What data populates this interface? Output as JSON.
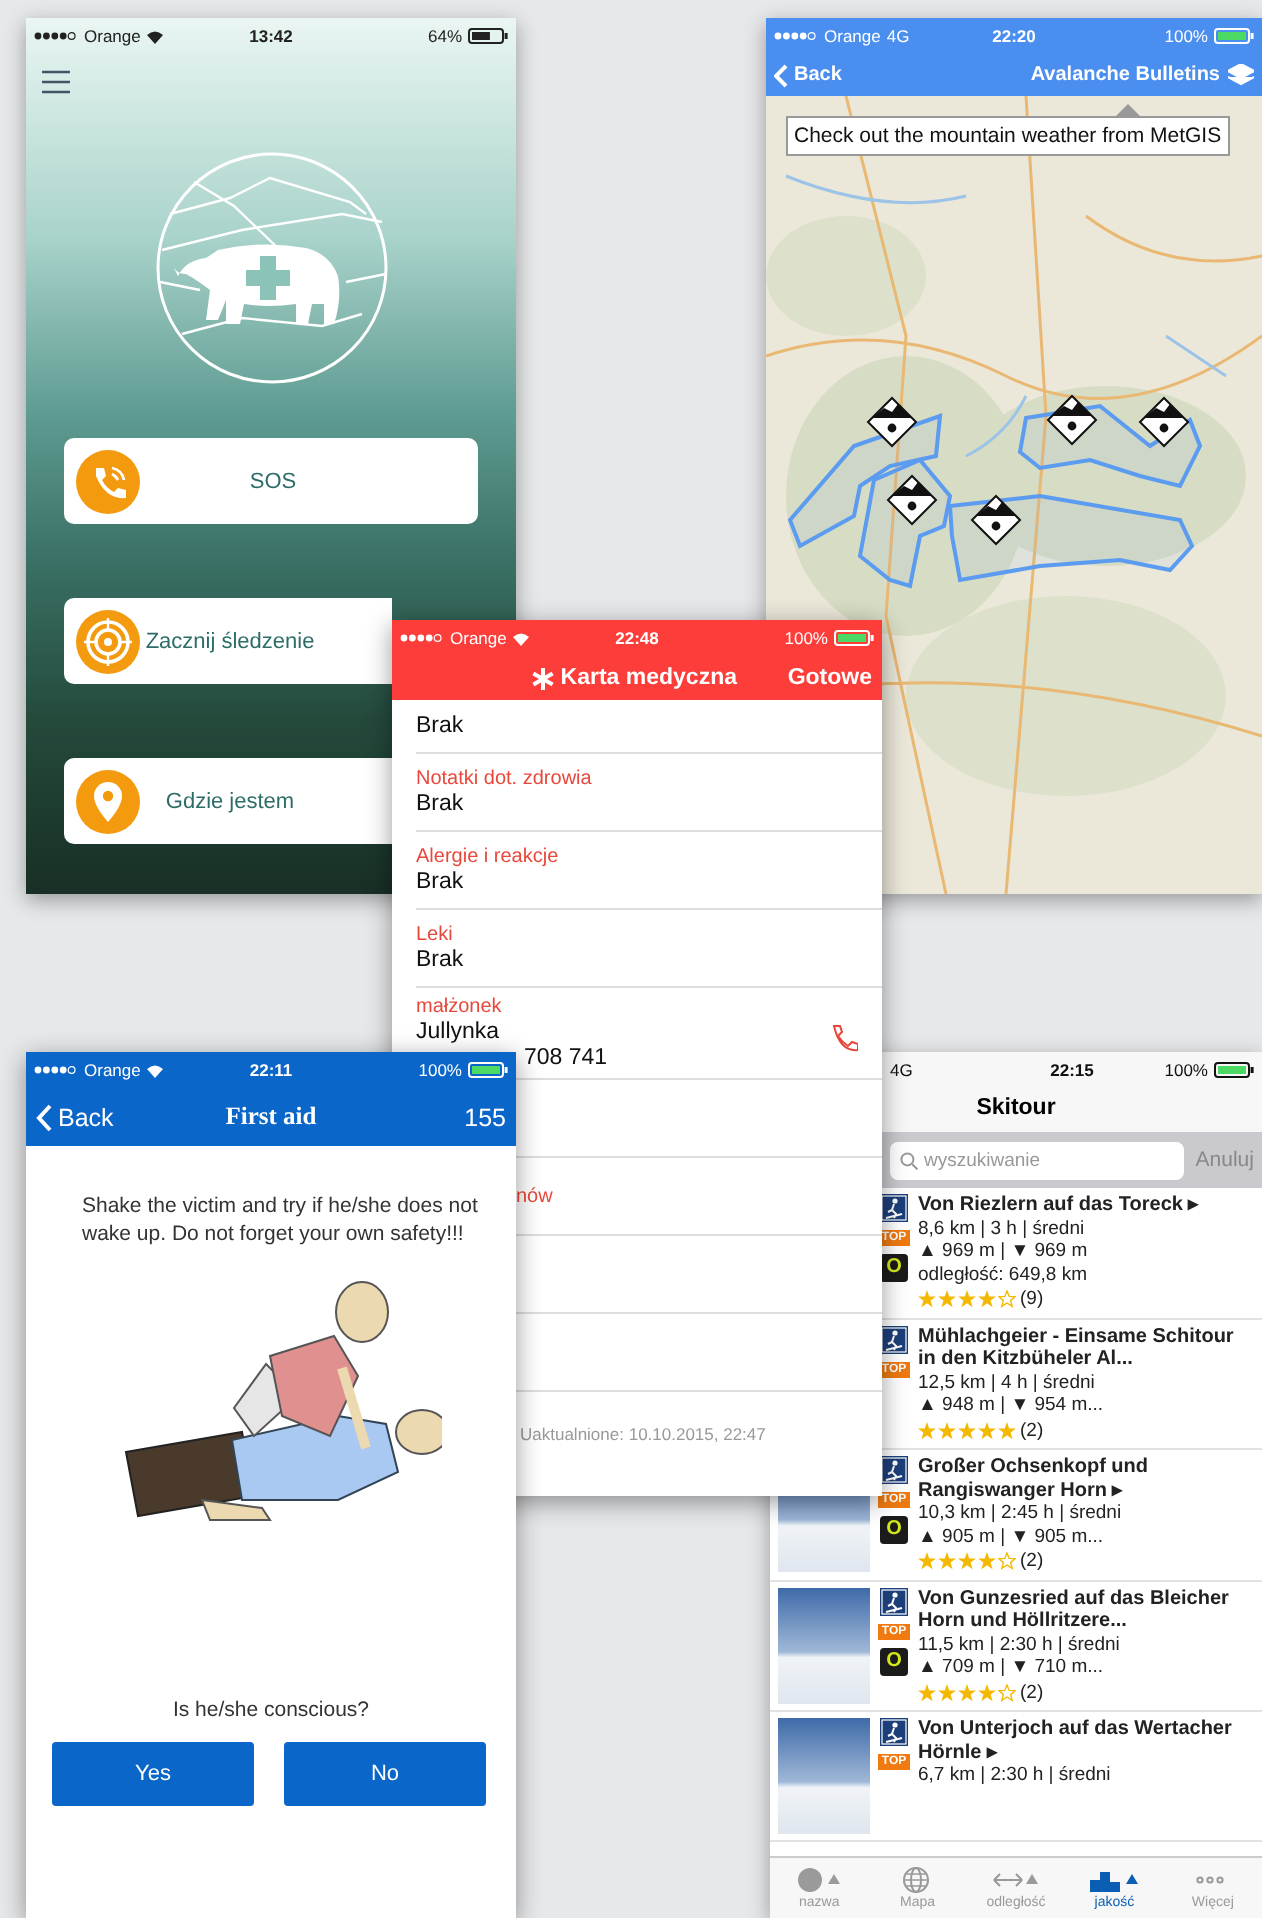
{
  "home_screen": {
    "status_bar": {
      "carrier": "Orange",
      "time": "13:42",
      "battery": "64%"
    },
    "buttons": [
      {
        "label": "SOS",
        "kind": "phone"
      },
      {
        "label": "Zacznij śledzenie",
        "kind": "target"
      },
      {
        "label": "Gdzie jestem",
        "kind": "pin"
      }
    ]
  },
  "map_screen": {
    "status_bar": {
      "carrier": "Orange",
      "network": "4G",
      "time": "22:20",
      "battery": "100%"
    },
    "back": "Back",
    "title": "Avalanche Bulletins",
    "banner": "Check out the mountain weather from MetGIS"
  },
  "skitour": {
    "status_bar": {
      "network": "4G",
      "time": "22:15",
      "battery": "100%"
    },
    "title": "Skitour",
    "search": {
      "placeholder": "wyszukiwanie"
    },
    "cancel": "Anuluj",
    "tours": [
      {
        "title": "Von Riezlern auf das Toreck ▸",
        "details": [
          "8,6 km | 3 h | średni",
          "▲ 969 m | ▼ 969 m",
          "odległość: 649,8 km"
        ],
        "top": "TOP",
        "grade": "O",
        "stars": 4,
        "reviews": "(9)"
      },
      {
        "title": "Mühlachgeier - Einsame Schitour in den Kitzbüheler Al...",
        "details": [
          "12,5 km | 4 h | średni",
          "▲ 948 m | ▼ 954 m..."
        ],
        "top": "TOP",
        "stars": 5,
        "reviews": "(2)"
      },
      {
        "title": "Großer Ochsenkopf und Rangiswanger Horn ▸",
        "details": [
          "10,3 km | 2:45 h | średni",
          "▲ 905 m | ▼ 905 m..."
        ],
        "top": "TOP",
        "grade": "O",
        "stars": 4,
        "reviews": "(2)"
      },
      {
        "title": "Von Gunzesried auf das Bleicher Horn und Höllritzere...",
        "details": [
          "11,5 km | 2:30 h | średni",
          "▲ 709 m | ▼ 710 m..."
        ],
        "top": "TOP",
        "grade": "O",
        "stars": 4,
        "reviews": "(2)"
      },
      {
        "title": "Von Unterjoch auf das Wertacher Hörnle ▸",
        "details": [
          "6,7 km | 2:30 h | średni"
        ],
        "top": "TOP"
      }
    ],
    "tabs": [
      {
        "label": "nazwa",
        "selected": false
      },
      {
        "label": "Mapa",
        "selected": false
      },
      {
        "label": "odległość",
        "selected": false
      },
      {
        "label": "jakość",
        "selected": true
      },
      {
        "label": "Więcej",
        "selected": false
      }
    ]
  },
  "medical_card": {
    "status_bar": {
      "carrier": "Orange",
      "time": "22:48",
      "battery": "100%"
    },
    "title": "Karta medyczna",
    "done": "Gotowe",
    "fields": [
      {
        "value": "Brak"
      },
      {
        "label": "Notatki dot. zdrowia",
        "value": "Brak"
      },
      {
        "label": "Alergie i reakcje",
        "value": "Brak"
      },
      {
        "label": "Leki",
        "value": "Brak"
      },
      {
        "label": "małżonek",
        "value": "Jullynka",
        "phone": "708 741"
      },
      {
        "label": "nów"
      }
    ],
    "updated": "Uaktualnione: 10.10.2015, 22:47"
  },
  "first_aid": {
    "status_bar": {
      "carrier": "Orange",
      "time": "22:11",
      "battery": "100%"
    },
    "back": "Back",
    "title": "First aid",
    "emergency_number": "155",
    "instruction": "Shake the victim and try if he/she does not wake up. Do not forget your own safety!!!",
    "question": "Is he/she conscious?",
    "answers": [
      "Yes",
      "No"
    ]
  }
}
